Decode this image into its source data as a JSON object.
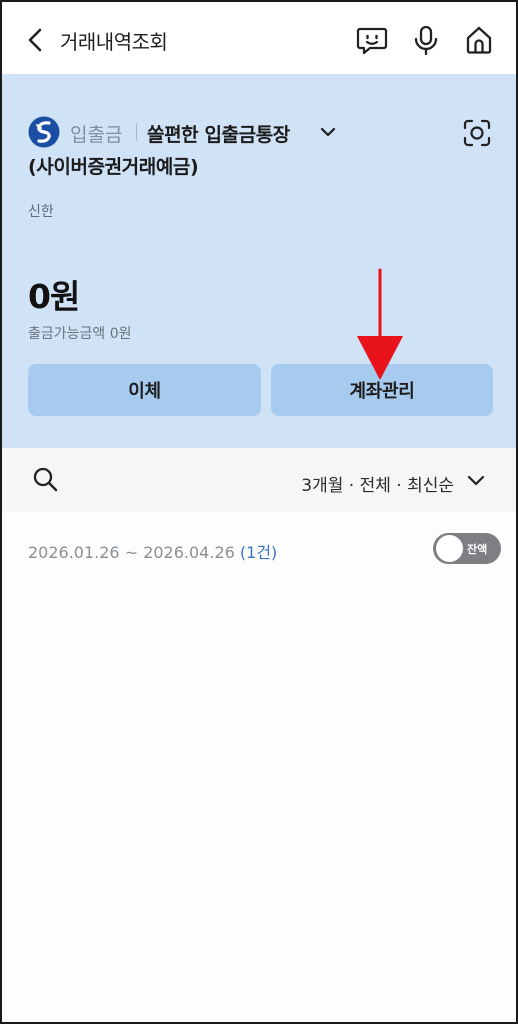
{
  "header": {
    "title": "거래내역조회"
  },
  "account": {
    "type": "입출금",
    "name": "쏠편한 입출금통장",
    "subname": "(사이버증권거래예금)",
    "bank": "신한",
    "balance": "0원",
    "withdrawable": "출금가능금액 0원"
  },
  "actions": {
    "transfer": "이체",
    "manage": "계좌관리"
  },
  "filter": {
    "label": "3개월 · 전체 · 최신순"
  },
  "list": {
    "period": "2026.01.26 ~ 2026.04.26",
    "count": "(1건)",
    "balance_toggle": "잔액"
  },
  "colors": {
    "panel_bg": "#cfe2f6",
    "button_bg": "#a6cbef",
    "annotation": "#e8131b",
    "accent": "#3f74c4"
  },
  "icons": [
    "back-icon",
    "chatbot-icon",
    "microphone-icon",
    "home-icon",
    "shinhan-logo-icon",
    "chevron-down-icon",
    "scan-icon",
    "search-icon",
    "annotation-arrow"
  ]
}
